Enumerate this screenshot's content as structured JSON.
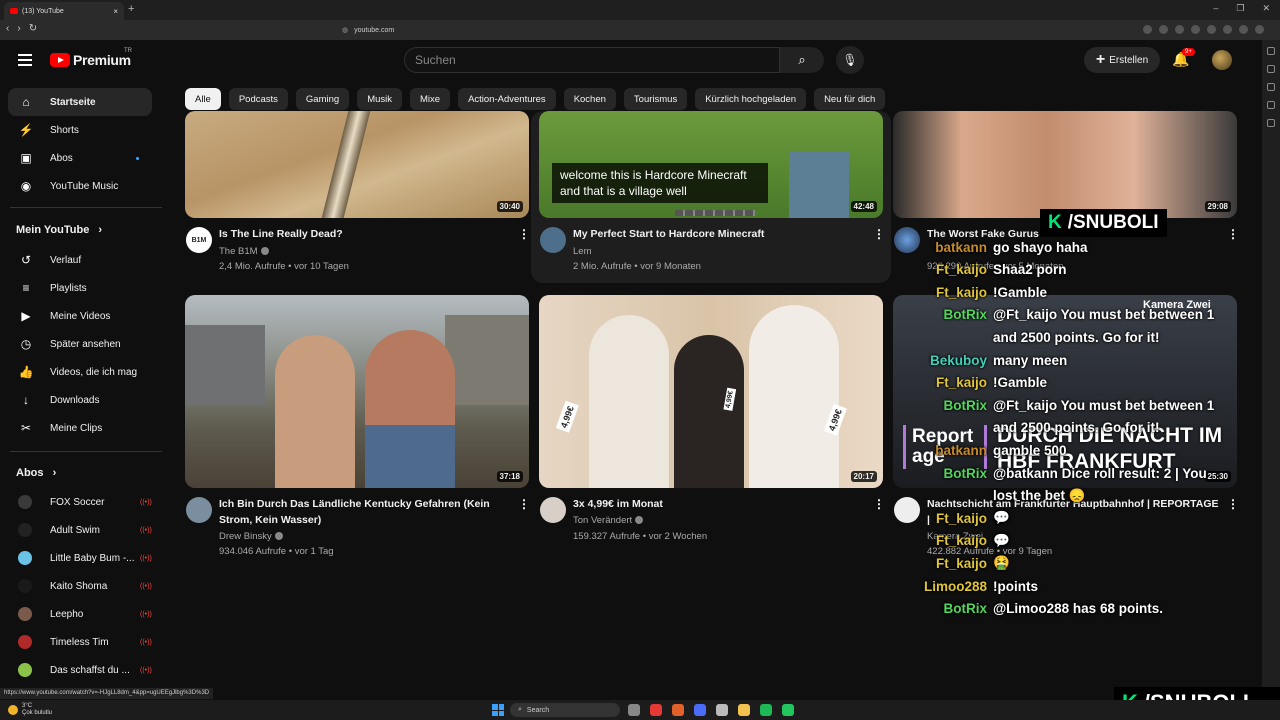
{
  "browser": {
    "tab_title": "(13) YouTube",
    "tab_close": "×",
    "new_tab": "+",
    "url": "youtube.com",
    "nav": [
      "‹",
      "›",
      "↻"
    ],
    "window_controls": [
      "–",
      "❐",
      "✕"
    ]
  },
  "header": {
    "logo_text": "Premium",
    "country_code": "TR",
    "search_placeholder": "Suchen",
    "create_label": "Erstellen",
    "notification_count": "9+"
  },
  "sidebar": {
    "main": [
      {
        "label": "Startseite",
        "icon": "home-icon",
        "glyph": "⌂"
      },
      {
        "label": "Shorts",
        "icon": "shorts-icon",
        "glyph": "⚡"
      },
      {
        "label": "Abos",
        "icon": "subscriptions-icon",
        "glyph": "▣"
      },
      {
        "label": "YouTube Music",
        "icon": "music-icon",
        "glyph": "◉"
      }
    ],
    "you_heading": "Mein YouTube",
    "you_items": [
      {
        "label": "Verlauf",
        "icon": "history-icon",
        "glyph": "↺"
      },
      {
        "label": "Playlists",
        "icon": "playlists-icon",
        "glyph": "≡"
      },
      {
        "label": "Meine Videos",
        "icon": "my-videos-icon",
        "glyph": "▶"
      },
      {
        "label": "Später ansehen",
        "icon": "watch-later-icon",
        "glyph": "◷"
      },
      {
        "label": "Videos, die ich mag",
        "icon": "liked-videos-icon",
        "glyph": "👍"
      },
      {
        "label": "Downloads",
        "icon": "downloads-icon",
        "glyph": "↓"
      },
      {
        "label": "Meine Clips",
        "icon": "clips-icon",
        "glyph": "✂"
      }
    ],
    "subs_heading": "Abos",
    "subs": [
      {
        "label": "FOX Soccer",
        "color": "#3a3a3a"
      },
      {
        "label": "Adult Swim",
        "color": "#222222"
      },
      {
        "label": "Little Baby Bum -...",
        "color": "#6ac3e6"
      },
      {
        "label": "Kaito Shoma",
        "color": "#1a1a1a"
      },
      {
        "label": "Leepho",
        "color": "#7a5a4a"
      },
      {
        "label": "Timeless Tim",
        "color": "#b02a2a"
      },
      {
        "label": "Das schaffst du ...",
        "color": "#8bc34a"
      }
    ],
    "live_indicator": "((•))"
  },
  "chips": [
    "Alle",
    "Podcasts",
    "Gaming",
    "Musik",
    "Mixe",
    "Action-Adventures",
    "Kochen",
    "Tourismus",
    "Kürzlich hochgeladen",
    "Neu für dich"
  ],
  "videos": [
    {
      "title": "Is The Line Really Dead?",
      "channel": "The B1M",
      "meta": "2,4 Mio. Aufrufe • vor 10 Tagen",
      "duration": "30:40"
    },
    {
      "title": "My Perfect Start to Hardcore Minecraft",
      "channel": "Lem",
      "meta": "2 Mio. Aufrufe • vor 9 Monaten",
      "duration": "42:48",
      "caption": "welcome this is Hardcore Minecraft and that is a village well"
    },
    {
      "title": "The Worst Fake Gurus",
      "channel": "",
      "meta": "926.290 Aufrufe • vor 5 Monaten",
      "duration": "29:08"
    },
    {
      "title": "Ich Bin Durch Das Ländliche Kentucky Gefahren (Kein Strom, Kein Wasser)",
      "channel": "Drew Binsky",
      "meta": "934.046 Aufrufe • vor 1 Tag",
      "duration": "37:18"
    },
    {
      "title": "3x 4,99€ im Monat",
      "channel": "Ton Verändert",
      "meta": "159.327 Aufrufe • vor 2 Wochen",
      "duration": "20:17",
      "price_tags": [
        "4,99€",
        "4,99€",
        "4,99€"
      ]
    },
    {
      "title": "Nachtschicht am Frankfurter Hauptbahnhof | REPORTAGE |",
      "channel": "Kamera Zwei",
      "meta": "422.882 Aufrufe • vor 9 Tagen",
      "duration": "25:30",
      "thumb_text": "DURCH DIE NACHT IM HBF FRANKFURT",
      "thumb_label": "Kamera Zwei",
      "report_label": "Report age"
    }
  ],
  "overlay": {
    "brand": "/SNUBOLI",
    "chat": [
      {
        "user": "batkann",
        "msg": "go shayo haha",
        "color": "#c58b2e"
      },
      {
        "user": "Ft_kaijo",
        "msg": "Shaa2 porn",
        "color": "#e0c43a"
      },
      {
        "user": "Ft_kaijo",
        "msg": "!Gamble",
        "color": "#e0c43a"
      },
      {
        "user": "BotRix",
        "msg": "@Ft_kaijo You must bet between 1",
        "color": "#52d65c"
      },
      {
        "user": "",
        "msg": "and 2500 points. Go for it!",
        "color": "#ffffff"
      },
      {
        "user": "Bekuboy",
        "msg": "many meen",
        "color": "#3ed0b8"
      },
      {
        "user": "Ft_kaijo",
        "msg": "!Gamble",
        "color": "#e0c43a"
      },
      {
        "user": "BotRix",
        "msg": "@Ft_kaijo You must bet between 1",
        "color": "#52d65c"
      },
      {
        "user": "",
        "msg": "and 2500 points. Go for it!",
        "color": "#ffffff"
      },
      {
        "user": "batkann",
        "msg": "gamble 500",
        "color": "#c58b2e"
      },
      {
        "user": "BotRix",
        "msg": "@batkann Dice roll result: 2 | You",
        "color": "#52d65c"
      },
      {
        "user": "",
        "msg": "lost the bet 😞",
        "color": "#ffffff"
      },
      {
        "user": "Ft_kaijo",
        "msg": "💬",
        "color": "#e0c43a"
      },
      {
        "user": "Ft_kaijo",
        "msg": "💬",
        "color": "#e0c43a"
      },
      {
        "user": "Ft_kaijo",
        "msg": "🤮",
        "color": "#e0c43a"
      },
      {
        "user": "Limoo288",
        "msg": "!points",
        "color": "#e0c43a"
      },
      {
        "user": "BotRix",
        "msg": "@Limoo288 has 68 points.",
        "color": "#52d65c"
      }
    ]
  },
  "status_url": "https://www.youtube.com/watch?v=-HJgLL8dm_4&pp=ugUEEgJlbg%3D%3D",
  "taskbar": {
    "weather_temp": "3°C",
    "weather_desc": "Çok bulutlu",
    "search_label": "Search",
    "app_colors": [
      "#888888",
      "#e53935",
      "#e0622a",
      "#4a6cf7",
      "#bbbbbb",
      "#f2c14e",
      "#1db954",
      "#22c55e"
    ]
  }
}
